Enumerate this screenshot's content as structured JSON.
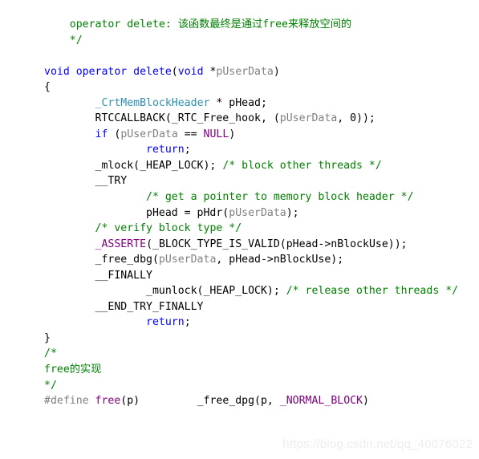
{
  "document": {
    "kind": "code-listing",
    "language": "C++",
    "background_color": "#ffffff"
  },
  "theme": {
    "comment_color": "#008000",
    "keyword_color": "#0000ff",
    "type_color": "#2b91af",
    "macro_color": "#800080",
    "parameter_color": "#808080",
    "preprocessor_color": "#808080",
    "plain_color": "#000000",
    "watermark_color": "#ededed"
  },
  "code": {
    "lines": [
      {
        "id": "line-1",
        "tokens": [
          {
            "cls": "cm",
            "text": "    operator delete: 该函数最终是通过free来释放空间的"
          }
        ]
      },
      {
        "id": "line-2",
        "tokens": [
          {
            "cls": "cm",
            "text": "    */"
          }
        ]
      },
      {
        "id": "line-3",
        "tokens": [
          {
            "cls": "pl",
            "text": ""
          }
        ]
      },
      {
        "id": "line-4",
        "tokens": [
          {
            "cls": "kw",
            "text": "void operator delete"
          },
          {
            "cls": "pl",
            "text": "("
          },
          {
            "cls": "kw",
            "text": "void"
          },
          {
            "cls": "pl",
            "text": " *"
          },
          {
            "cls": "pm",
            "text": "pUserData"
          },
          {
            "cls": "pl",
            "text": ")"
          }
        ]
      },
      {
        "id": "line-5",
        "tokens": [
          {
            "cls": "pl",
            "text": "{"
          }
        ]
      },
      {
        "id": "line-6",
        "tokens": [
          {
            "cls": "pl",
            "text": "        "
          },
          {
            "cls": "ty",
            "text": "_CrtMemBlockHeader"
          },
          {
            "cls": "pl",
            "text": " * pHead;"
          }
        ]
      },
      {
        "id": "line-7",
        "tokens": [
          {
            "cls": "pl",
            "text": "        RTCCALLBACK(_RTC_Free_hook, ("
          },
          {
            "cls": "pm",
            "text": "pUserData"
          },
          {
            "cls": "pl",
            "text": ", 0));"
          }
        ]
      },
      {
        "id": "line-8",
        "tokens": [
          {
            "cls": "pl",
            "text": "        "
          },
          {
            "cls": "kw",
            "text": "if"
          },
          {
            "cls": "pl",
            "text": " ("
          },
          {
            "cls": "pm",
            "text": "pUserData"
          },
          {
            "cls": "pl",
            "text": " == "
          },
          {
            "cls": "mc",
            "text": "NULL"
          },
          {
            "cls": "pl",
            "text": ")"
          }
        ]
      },
      {
        "id": "line-9",
        "tokens": [
          {
            "cls": "pl",
            "text": "                "
          },
          {
            "cls": "kw",
            "text": "return"
          },
          {
            "cls": "pl",
            "text": ";"
          }
        ]
      },
      {
        "id": "line-10",
        "tokens": [
          {
            "cls": "pl",
            "text": "        _mlock(_HEAP_LOCK); "
          },
          {
            "cls": "cm",
            "text": "/* block other threads */"
          }
        ]
      },
      {
        "id": "line-11",
        "tokens": [
          {
            "cls": "pl",
            "text": "        __TRY"
          }
        ]
      },
      {
        "id": "line-12",
        "tokens": [
          {
            "cls": "pl",
            "text": "                "
          },
          {
            "cls": "cm",
            "text": "/* get a pointer to memory block header */"
          }
        ]
      },
      {
        "id": "line-13",
        "tokens": [
          {
            "cls": "pl",
            "text": "                pHead = pHdr("
          },
          {
            "cls": "pm",
            "text": "pUserData"
          },
          {
            "cls": "pl",
            "text": ");"
          }
        ]
      },
      {
        "id": "line-14",
        "tokens": [
          {
            "cls": "pl",
            "text": "        "
          },
          {
            "cls": "cm",
            "text": "/* verify block type */"
          }
        ]
      },
      {
        "id": "line-15",
        "tokens": [
          {
            "cls": "pl",
            "text": "        "
          },
          {
            "cls": "mc",
            "text": "_ASSERTE"
          },
          {
            "cls": "pl",
            "text": "(_BLOCK_TYPE_IS_VALID(pHead->nBlockUse));"
          }
        ]
      },
      {
        "id": "line-16",
        "tokens": [
          {
            "cls": "pl",
            "text": "        _free_dbg("
          },
          {
            "cls": "pm",
            "text": "pUserData"
          },
          {
            "cls": "pl",
            "text": ", pHead->nBlockUse);"
          }
        ]
      },
      {
        "id": "line-17",
        "tokens": [
          {
            "cls": "pl",
            "text": "        __FINALLY"
          }
        ]
      },
      {
        "id": "line-18",
        "tokens": [
          {
            "cls": "pl",
            "text": "                _munlock(_HEAP_LOCK); "
          },
          {
            "cls": "cm",
            "text": "/* release other threads */"
          }
        ]
      },
      {
        "id": "line-19",
        "tokens": [
          {
            "cls": "pl",
            "text": "        __END_TRY_FINALLY"
          }
        ]
      },
      {
        "id": "line-20",
        "tokens": [
          {
            "cls": "pl",
            "text": "                "
          },
          {
            "cls": "kw",
            "text": "return"
          },
          {
            "cls": "pl",
            "text": ";"
          }
        ]
      },
      {
        "id": "line-21",
        "tokens": [
          {
            "cls": "pl",
            "text": "}"
          }
        ]
      },
      {
        "id": "line-22",
        "tokens": [
          {
            "cls": "cm",
            "text": "/*"
          }
        ]
      },
      {
        "id": "line-23",
        "tokens": [
          {
            "cls": "cm",
            "text": "free的实现"
          }
        ]
      },
      {
        "id": "line-24",
        "tokens": [
          {
            "cls": "cm",
            "text": "*/"
          }
        ]
      },
      {
        "id": "line-25",
        "tokens": [
          {
            "cls": "pp",
            "text": "#define "
          },
          {
            "cls": "mc",
            "text": "free"
          },
          {
            "cls": "pl",
            "text": "(p)         _free_dpg(p, "
          },
          {
            "cls": "mc",
            "text": "_NORMAL_BLOCK"
          },
          {
            "cls": "pl",
            "text": ")"
          }
        ]
      }
    ]
  },
  "watermark": {
    "text": "https://blog.csdn.net/qq_40076022"
  }
}
